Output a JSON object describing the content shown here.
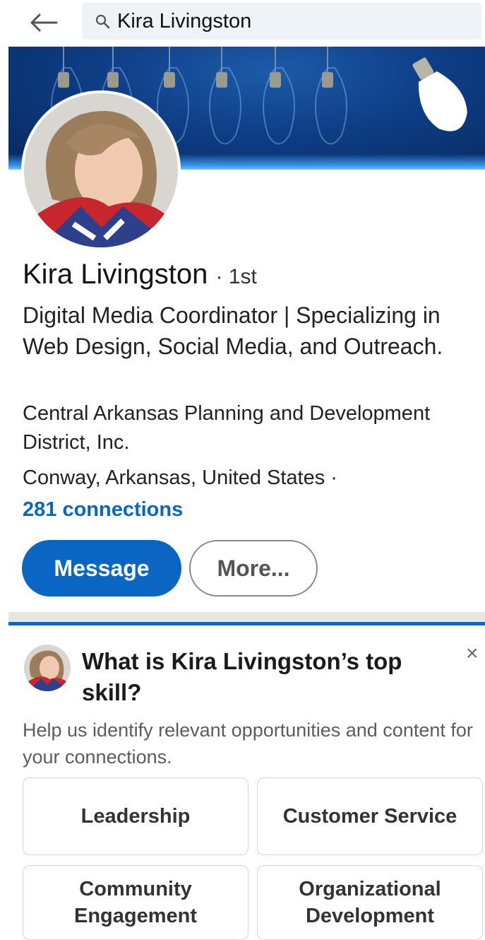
{
  "search": {
    "query": "Kira Livingston"
  },
  "profile": {
    "name": "Kira Livingston",
    "degree": "· 1st",
    "headline": "Digital Media Coordinator | Specializing in Web Design, Social Media, and Outreach.",
    "company": "Central Arkansas Planning and Development District, Inc.",
    "location": "Conway, Arkansas, United States ·",
    "connections": "281 connections"
  },
  "actions": {
    "message": "Message",
    "more": "More..."
  },
  "skills": {
    "question": "What is Kira Livingston’s top skill?",
    "help": "Help us identify relevant opportunities and content for your connections.",
    "close": "×",
    "options": [
      "Leadership",
      "Customer Service",
      "Community Engagement",
      "Organizational Development"
    ]
  },
  "colors": {
    "accent": "#0a66c2",
    "search_bg": "#eef3f8",
    "banner": "#0e3e86"
  },
  "icons": {
    "back": "arrow-left-icon",
    "search": "search-icon",
    "close": "close-icon"
  }
}
